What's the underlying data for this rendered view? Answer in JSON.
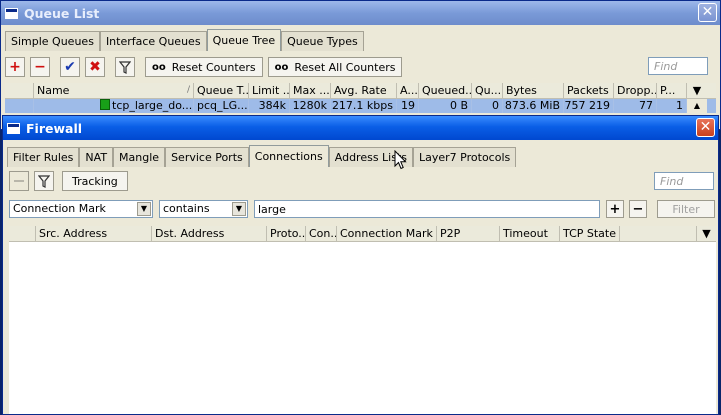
{
  "queue_list": {
    "title": "Queue List",
    "close": "✕",
    "tabs": [
      "Simple Queues",
      "Interface Queues",
      "Queue Tree",
      "Queue Types"
    ],
    "active_tab": "Queue Tree",
    "toolbar": {
      "add": "+",
      "remove": "−",
      "enable": "✔",
      "disable": "✖",
      "filter_icon": "funnel-icon",
      "reset_counters_icon": "oo",
      "reset_counters": "Reset Counters",
      "reset_all_counters_icon": "oo",
      "reset_all_counters": "Reset All Counters",
      "find_placeholder": "Find"
    },
    "columns": [
      "Name",
      "Queue T...",
      "Limit ...",
      "Max ...",
      "Avg. Rate",
      "A...",
      "Queued...",
      "Qu...",
      "Bytes",
      "Packets",
      "Dropp...",
      "P..."
    ],
    "row": {
      "name": "tcp_large_do...",
      "queue_type": "pcq_LG...",
      "limit_at": "384k",
      "max_limit": "1280k",
      "avg_rate": "217.1 kbps",
      "a": "19",
      "queued": "0 B",
      "qu": "0",
      "bytes": "873.6 MiB",
      "packets": "757 219",
      "dropped": "77",
      "p": "1"
    }
  },
  "firewall": {
    "title": "Firewall",
    "close": "✕",
    "tabs": [
      "Filter Rules",
      "NAT",
      "Mangle",
      "Service Ports",
      "Connections",
      "Address Lists",
      "Layer7 Protocols"
    ],
    "active_tab": "Connections",
    "toolbar": {
      "tracking": "Tracking",
      "find_placeholder": "Find"
    },
    "filter": {
      "field": "Connection Mark",
      "operator": "contains",
      "value": "large",
      "add": "+",
      "remove": "−",
      "apply": "Filter"
    },
    "columns": [
      "Src. Address",
      "Dst. Address",
      "Proto...",
      "Con...",
      "Connection Mark",
      "P2P",
      "Timeout",
      "TCP State"
    ]
  },
  "colors": {
    "title_active": "#0a5ee6",
    "title_inactive": "#7a9ad8",
    "selected_row": "#9ebbe8",
    "window_bg": "#ece9d8"
  }
}
